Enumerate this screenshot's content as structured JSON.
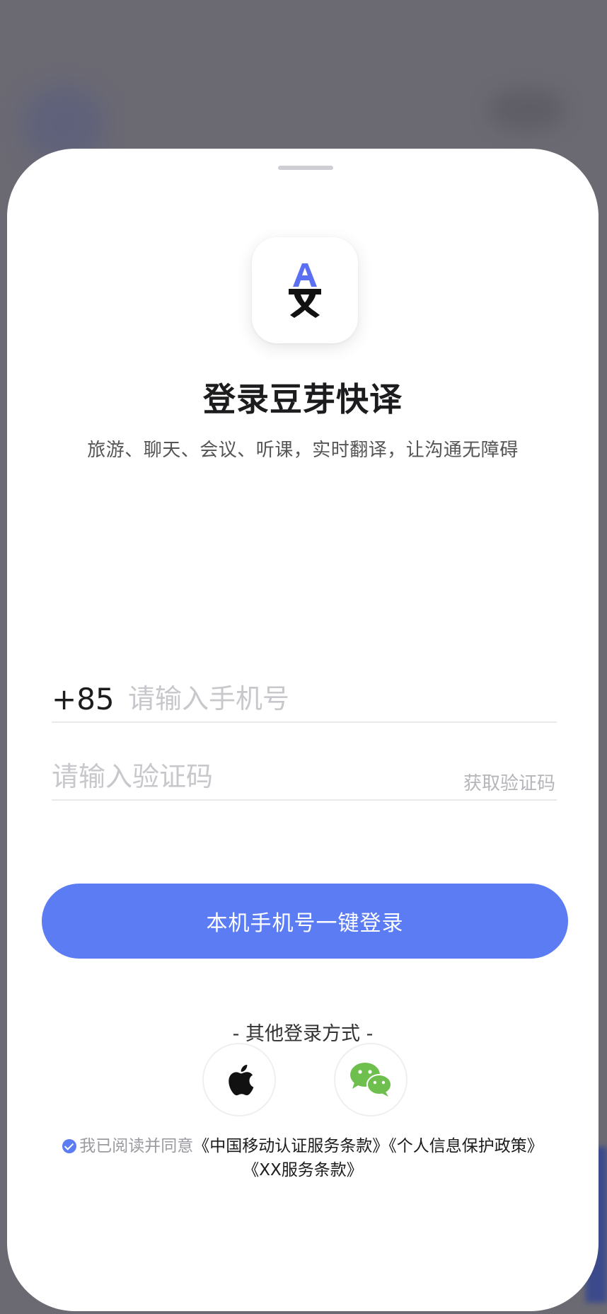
{
  "app": {
    "title": "登录豆芽快译",
    "subtitle": "旅游、聊天、会议、听课，实时翻译，让沟通无障碍",
    "icon": "translate-icon",
    "accent_color": "#5b7cf2"
  },
  "form": {
    "country_code": "+85",
    "phone_placeholder": "请输入手机号",
    "code_placeholder": "请输入验证码",
    "get_code_label": "获取验证码"
  },
  "login_button": {
    "label": "本机手机号一键登录"
  },
  "other_login": {
    "title": "- 其他登录方式 -",
    "options": [
      {
        "name": "apple",
        "icon": "apple-icon"
      },
      {
        "name": "wechat",
        "icon": "wechat-icon"
      }
    ]
  },
  "agreement": {
    "prefix": "我已阅读并同意",
    "link1": "《中国移动认证服务条款》",
    "link2": "《个人信息保护政策》",
    "link3": "《XX服务条款》"
  }
}
